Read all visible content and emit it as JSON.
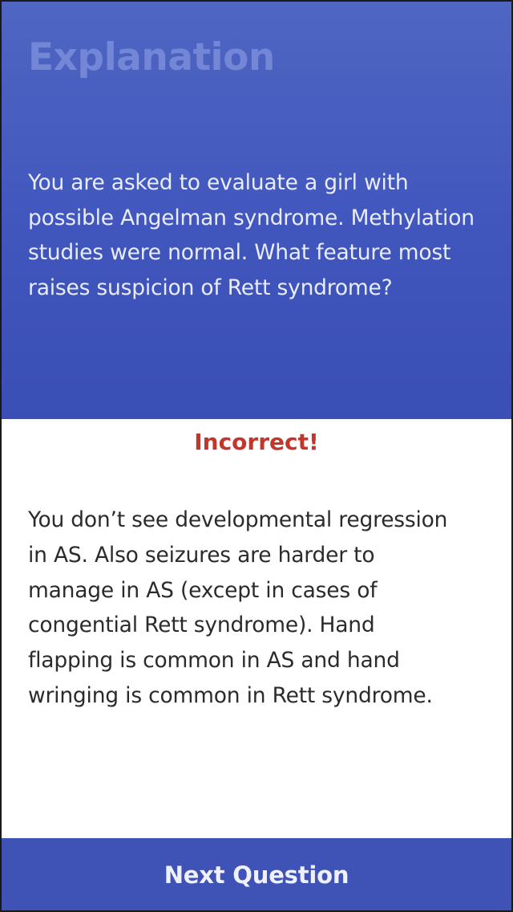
{
  "header": {
    "title": "Explanation",
    "question": "You are asked to evaluate a girl with possible Angelman syndrome. Methylation studies were normal. What feature most raises suspicion of Rett syndrome?"
  },
  "result": {
    "status": "Incorrect!",
    "explanation": "You don’t see developmental regression in AS. Also seizures are harder to manage in AS (except in cases of congential Rett syndrome). Hand flapping is common in AS and hand wringing is common in Rett syndrome."
  },
  "footer": {
    "next_label": "Next Question"
  },
  "colors": {
    "header_background": "#4156bd",
    "title": "#7486d6",
    "incorrect": "#c3362b",
    "button_background": "#3f52b5"
  }
}
